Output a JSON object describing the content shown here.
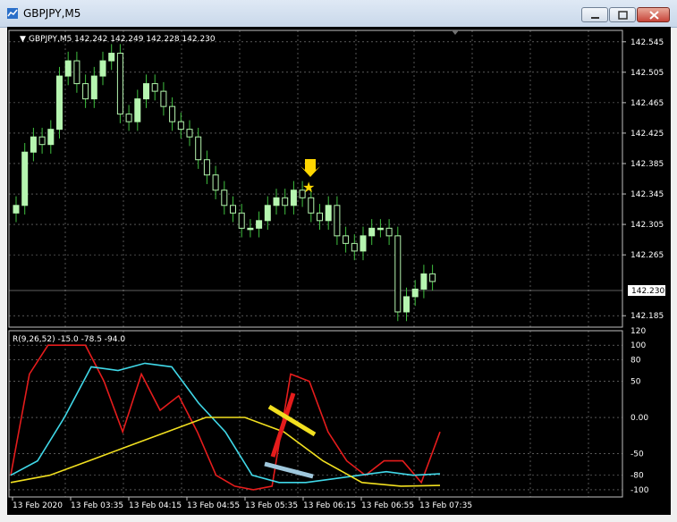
{
  "window": {
    "title": "GBPJPY,M5",
    "minimize_icon": "minimize-icon",
    "maximize_icon": "maximize-icon",
    "close_icon": "close-icon"
  },
  "main_chart": {
    "header": "GBPJPY,M5  142.242 142.249 142.228 142.230",
    "price_levels": [
      "142.545",
      "142.505",
      "142.465",
      "142.425",
      "142.385",
      "142.345",
      "142.305",
      "142.265",
      "142.185"
    ],
    "current_price": "142.230",
    "current_price_value": 142.23,
    "marker_star_color": "#ffd700",
    "marker_arrow_color": "#ffd700"
  },
  "indicator": {
    "header": "R(9,26,52) -15.0 -78.5 -94.0",
    "levels": [
      "120",
      "100",
      "80",
      "50",
      "0.00",
      "-50",
      "-80",
      "-100"
    ]
  },
  "time_axis": {
    "labels": [
      "13 Feb 2020",
      "13 Feb 03:35",
      "13 Feb 04:15",
      "13 Feb 04:55",
      "13 Feb 05:35",
      "13 Feb 06:15",
      "13 Feb 06:55",
      "13 Feb 07:35"
    ]
  },
  "colors": {
    "background": "#000000",
    "grid": "#8c8c8c",
    "candle": "#b6f5b0",
    "wick": "#3fbf3f",
    "red_line": "#e51c1c",
    "cyan_line": "#40d8e8",
    "yellow_line": "#f2e020"
  },
  "chart_data": {
    "type": "candlestick",
    "title": "GBPJPY,M5",
    "ylim": [
      142.17,
      142.56
    ],
    "candles_close": [
      142.33,
      142.4,
      142.42,
      142.41,
      142.43,
      142.5,
      142.52,
      142.49,
      142.47,
      142.5,
      142.52,
      142.53,
      142.45,
      142.44,
      142.47,
      142.49,
      142.48,
      142.46,
      142.44,
      142.43,
      142.42,
      142.39,
      142.37,
      142.35,
      142.33,
      142.32,
      142.3,
      142.3,
      142.31,
      142.33,
      142.34,
      142.33,
      142.35,
      142.34,
      142.32,
      142.31,
      142.33,
      142.29,
      142.28,
      142.27,
      142.29,
      142.3,
      142.3,
      142.29,
      142.19,
      142.21,
      142.22,
      142.24,
      142.23
    ],
    "indicator": {
      "series": [
        {
          "color": "#e51c1c",
          "values": [
            -80,
            60,
            100,
            100,
            100,
            50,
            -20,
            60,
            10,
            30,
            -20,
            -80,
            -95,
            -100,
            -95,
            60,
            50,
            -20,
            -60,
            -80,
            -60,
            -60,
            -90,
            -20
          ]
        },
        {
          "color": "#40d8e8",
          "values": [
            -80,
            -60,
            0,
            70,
            65,
            75,
            70,
            20,
            -20,
            -80,
            -90,
            -90,
            -85,
            -80,
            -75,
            -80,
            -78
          ]
        },
        {
          "color": "#f2e020",
          "values": [
            -90,
            -80,
            -60,
            -40,
            -20,
            0,
            0,
            -20,
            -60,
            -90,
            -95,
            -94
          ]
        }
      ]
    }
  }
}
